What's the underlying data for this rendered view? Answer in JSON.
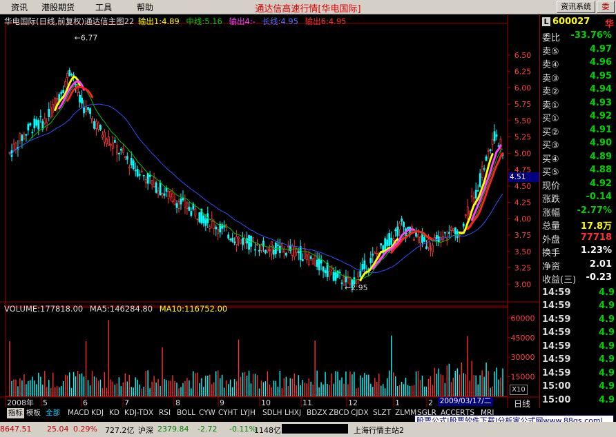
{
  "menu": {
    "items": [
      "资讯",
      "港股期货",
      "工具",
      "帮助"
    ],
    "title": "通达信高速行情",
    "title_suffix": "[华电国际]",
    "sys_btn": "资讯系统",
    "wei_btn": "委"
  },
  "chart_header": {
    "name": "华电国际(日线,前复权)通达信主图22",
    "out1": "输出1:4.89",
    "midline": "中线:5.16",
    "out4": "输出4:-",
    "longline": "长线:4.95",
    "out6": "输出6:4.95"
  },
  "volume_header": {
    "volume": "VOLUME:177818.00",
    "ma5": "MA5:146284.80",
    "ma10": "MA10:116752.00"
  },
  "price_flag": "4.51",
  "date_badge": "2009/03/17/二",
  "x10_label": "X10",
  "period_label": "日线",
  "chart_data": [
    {
      "type": "candlestick",
      "title": "华电国际(日线,前复权)",
      "y_ticks": [
        3.0,
        3.25,
        3.5,
        3.75,
        4.0,
        4.25,
        4.5,
        4.75,
        5.0,
        5.25,
        5.5,
        5.75,
        6.0,
        6.25,
        6.5
      ],
      "y_range": [
        2.75,
        6.9
      ],
      "x_ticks": [
        "2008年",
        "5",
        "6",
        "7",
        "8",
        "9",
        "10",
        "11",
        "12",
        "1",
        "2"
      ],
      "annotations": [
        {
          "text": "6.77",
          "type": "high"
        },
        {
          "text": "2.95",
          "type": "low"
        }
      ],
      "lines": {
        "midline": "中线",
        "longline": "长线",
        "out6": "输出6"
      },
      "colors": {
        "up": "#ff3030",
        "down": "#00ffff",
        "midline": "#00c000",
        "longline": "#3050ff",
        "yellow": "#ffff00",
        "magenta": "#ff40ff",
        "red": "#ff2020"
      }
    },
    {
      "type": "bar",
      "title": "VOLUME",
      "y_ticks": [
        15000,
        30000,
        45000,
        60000
      ],
      "y_range": [
        0,
        66000
      ],
      "series": [
        {
          "name": "MA5",
          "color": "#ffffff"
        },
        {
          "name": "MA10",
          "color": "#ffff00"
        }
      ]
    }
  ],
  "quote": {
    "code": "600027",
    "name_short": "华",
    "weibi_label": "委比",
    "weibi": "-33.76%",
    "sells": [
      {
        "label": "卖⑤",
        "price": "4.97"
      },
      {
        "label": "卖④",
        "price": "4.96"
      },
      {
        "label": "卖③",
        "price": "4.95"
      },
      {
        "label": "卖②",
        "price": "4.94"
      },
      {
        "label": "卖①",
        "price": "4.93"
      }
    ],
    "buys": [
      {
        "label": "买①",
        "price": "4.92"
      },
      {
        "label": "买②",
        "price": "4.91"
      },
      {
        "label": "买③",
        "price": "4.90"
      },
      {
        "label": "买④",
        "price": "4.89"
      },
      {
        "label": "买⑤",
        "price": "4.88"
      }
    ],
    "stats": [
      {
        "label": "现价",
        "value": "4.92",
        "color": "#00d000"
      },
      {
        "label": "涨跌",
        "value": "-0.14",
        "color": "#00d000"
      },
      {
        "label": "涨幅",
        "value": "-2.77%",
        "color": "#00d000"
      },
      {
        "label": "总量",
        "value": "17.8万",
        "color": "#ffff00"
      },
      {
        "label": "外盘",
        "value": "77718",
        "color": "#ff3030"
      },
      {
        "label": "换手",
        "value": "1.23%",
        "color": "#ffffff"
      },
      {
        "label": "净资",
        "value": "2.01",
        "color": "#ffffff"
      },
      {
        "label": "收益(三)",
        "value": "-0.23",
        "color": "#ffffff"
      }
    ],
    "ticks": [
      {
        "time": "14:59",
        "value": "4.9"
      },
      {
        "time": "14:59",
        "value": "4.9"
      },
      {
        "time": "14:59",
        "value": "4.9"
      },
      {
        "time": "14:59",
        "value": "4.9"
      },
      {
        "time": "14:59",
        "value": "4.9"
      },
      {
        "time": "14:59",
        "value": "4.9"
      },
      {
        "time": "14:59",
        "value": "4.9"
      },
      {
        "time": "15:00",
        "value": "4.9"
      },
      {
        "time": "15:00",
        "value": "4.9"
      }
    ]
  },
  "tabs": [
    "指标",
    "模板",
    "全部",
    "MACD",
    "KDJ",
    "KD",
    "KDJ-TDX",
    "RSI",
    "BOLL",
    "CYW",
    "CYHT",
    "LYJH",
    "SDLH",
    "LHXJ",
    "BDZX",
    "ZBCD",
    "CJDX",
    "SLZT",
    "ZLMM",
    "SGLR",
    "ACCER",
    "TS",
    "MRJ"
  ],
  "status": {
    "index1": "8647.51",
    "index1_chg": "25.04",
    "index1_pct": "0.29%",
    "turnover": "727.2亿",
    "sz_label": "沪深",
    "sz": "2379.84",
    "sz_chg": "-2.72",
    "sz_pct": "-0.11%",
    "sz_amt": "1148亿",
    "site": "上海行情主站2"
  },
  "ad": "股票公式|股票软件下载|分析家公式网www.88gs.com|"
}
